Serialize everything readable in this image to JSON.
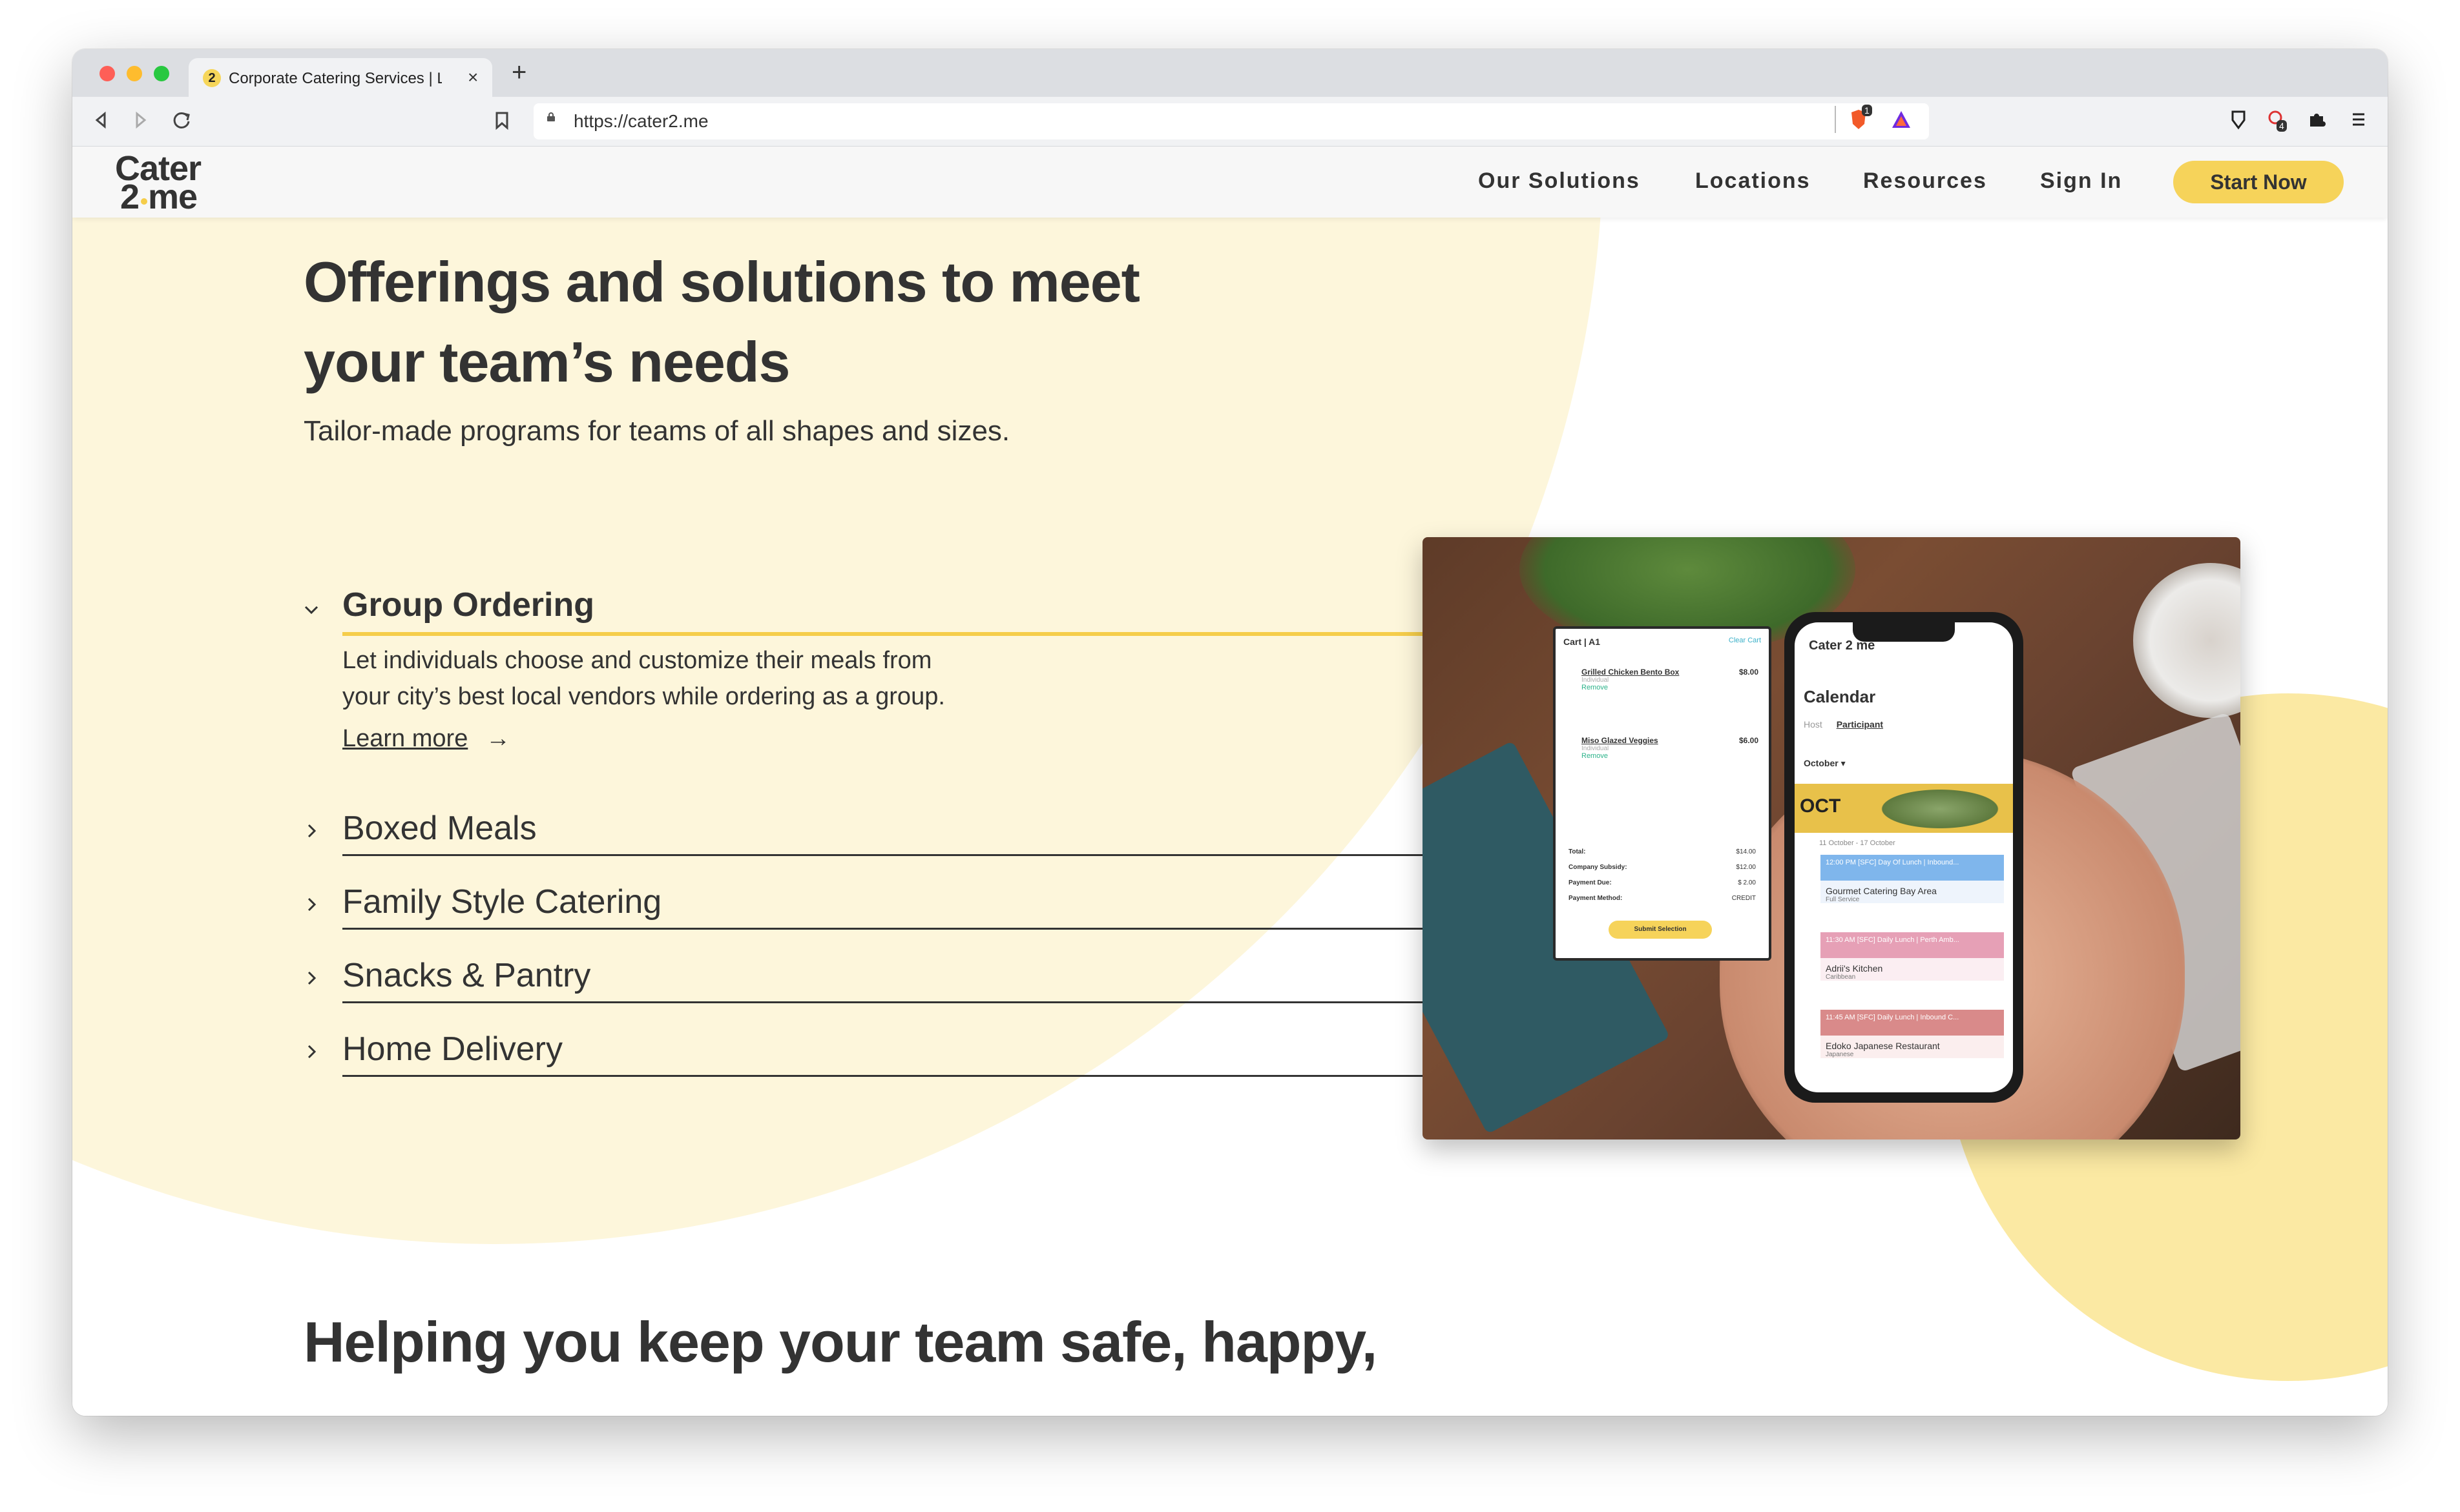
{
  "browser": {
    "tab_title": "Corporate Catering Services | L",
    "tab_favicon": "2",
    "close_glyph": "×",
    "newtab_glyph": "+",
    "url": "https://cater2.me",
    "brave_badge": "1",
    "ext_badge": "4"
  },
  "site": {
    "logo_line1": "Cater",
    "logo_line2": "2 me",
    "nav": [
      "Our Solutions",
      "Locations",
      "Resources",
      "Sign In"
    ],
    "cta": "Start Now",
    "colors": {
      "accent": "#f6d35a",
      "blob": "#fdf6db",
      "text": "#333333"
    }
  },
  "hero": {
    "title_line1": "Offerings and solutions to meet",
    "title_line2": "your team’s needs",
    "subtitle": "Tailor-made programs for teams of all shapes and sizes."
  },
  "accordion": {
    "open_item": {
      "label": "Group Ordering",
      "body_line1": "Let individuals choose and customize their meals from",
      "body_line2": "your city’s best local vendors while ordering as a group.",
      "learn_more": "Learn more",
      "arrow": "→"
    },
    "items": [
      "Boxed Meals",
      "Family Style Catering",
      "Snacks & Pantry",
      "Home Delivery"
    ]
  },
  "photo": {
    "cart": {
      "title": "Cart | A1",
      "clear": "Clear Cart",
      "items": [
        {
          "name": "Grilled Chicken Bento Box",
          "price": "$8.00",
          "note": "Individual",
          "remove": "Remove"
        },
        {
          "name": "Miso Glazed Veggies",
          "price": "$6.00",
          "note": "Individual",
          "remove": "Remove"
        }
      ],
      "totals": [
        {
          "label": "Total:",
          "value": "$14.00"
        },
        {
          "label": "Company Subsidy:",
          "value": "$12.00"
        },
        {
          "label": "Payment Due:",
          "value": "$ 2.00"
        },
        {
          "label": "Payment Method:",
          "value": "CREDIT"
        }
      ],
      "submit": "Submit Selection"
    },
    "phone": {
      "logo": "Cater 2 me",
      "title": "Calendar",
      "tab_host": "Host",
      "tab_participant": "Participant",
      "month": "October ▾",
      "banner": "OCT",
      "range": "11 October - 17 October",
      "events": [
        {
          "head": "12:00 PM [SFC] Day Of Lunch | Inbound...",
          "name": "Gourmet Catering Bay Area",
          "sub": "Full Service",
          "color": "#7fb6ec"
        },
        {
          "head": "11:30 AM [SFC] Daily Lunch | Perth Amb...",
          "name": "Adrii's Kitchen",
          "sub": "Caribbean",
          "color": "#e6a0b6"
        },
        {
          "head": "11:45 AM [SFC] Daily Lunch | Inbound C...",
          "name": "Edoko Japanese Restaurant",
          "sub": "Japanese",
          "color": "#d98a8a"
        }
      ]
    }
  },
  "section2": {
    "title_line1": "Helping you keep your team safe, happy,"
  }
}
